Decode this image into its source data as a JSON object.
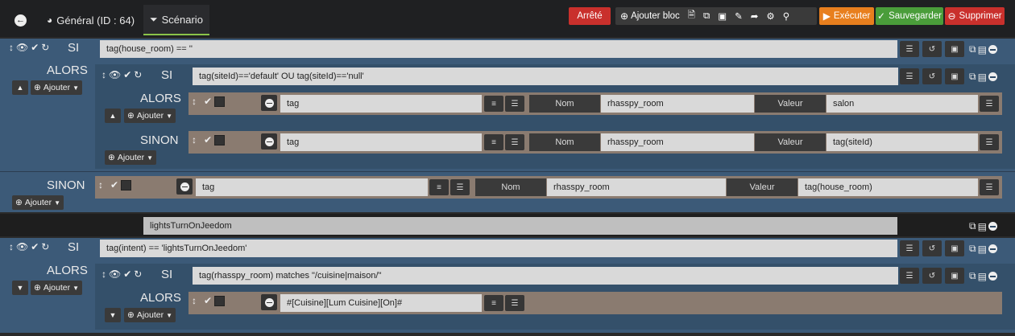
{
  "topbar": {
    "back_icon": "arrow-left-circle-icon",
    "tab_general": "Général (ID : 64)",
    "tab_scenario": "Scénario",
    "btn_stopped": "Arrêté",
    "btn_add_block": "Ajouter bloc",
    "btn_execute": "Exécuter",
    "btn_save": "Sauvegarder",
    "btn_delete": "Supprimer",
    "colors": {
      "stopped": "#c9302c",
      "execute": "#e87f1e",
      "save": "#4a9d3a",
      "delete": "#c9302c"
    }
  },
  "block1": {
    "si": "SI",
    "condition": "tag(house_room) == ''",
    "alors": "ALORS",
    "sinon": "SINON",
    "ajouter": "Ajouter",
    "nested": {
      "si": "SI",
      "condition": "tag(siteId)=='default' OU tag(siteId)=='null'",
      "alors": "ALORS",
      "sinon": "SINON",
      "ajouter": "Ajouter",
      "action_then": {
        "cmd": "tag",
        "nom_label": "Nom",
        "nom": "rhasspy_room",
        "valeur_label": "Valeur",
        "valeur": "salon"
      },
      "action_else": {
        "cmd": "tag",
        "nom_label": "Nom",
        "nom": "rhasspy_room",
        "valeur_label": "Valeur",
        "valeur": "tag(siteId)"
      }
    },
    "action_else": {
      "cmd": "tag",
      "nom_label": "Nom",
      "nom": "rhasspy_room",
      "valeur_label": "Valeur",
      "valeur": "tag(house_room)"
    }
  },
  "comment_block": {
    "text": "lightsTurnOnJeedom"
  },
  "block2": {
    "si": "SI",
    "condition": "tag(intent) == 'lightsTurnOnJeedom'",
    "alors": "ALORS",
    "ajouter": "Ajouter",
    "nested": {
      "si": "SI",
      "condition": "tag(rhasspy_room) matches \"/cuisine|maison/\"",
      "alors": "ALORS",
      "ajouter": "Ajouter",
      "action_then": {
        "cmd": "#[Cuisine][Lum Cuisine][On]#"
      }
    }
  }
}
